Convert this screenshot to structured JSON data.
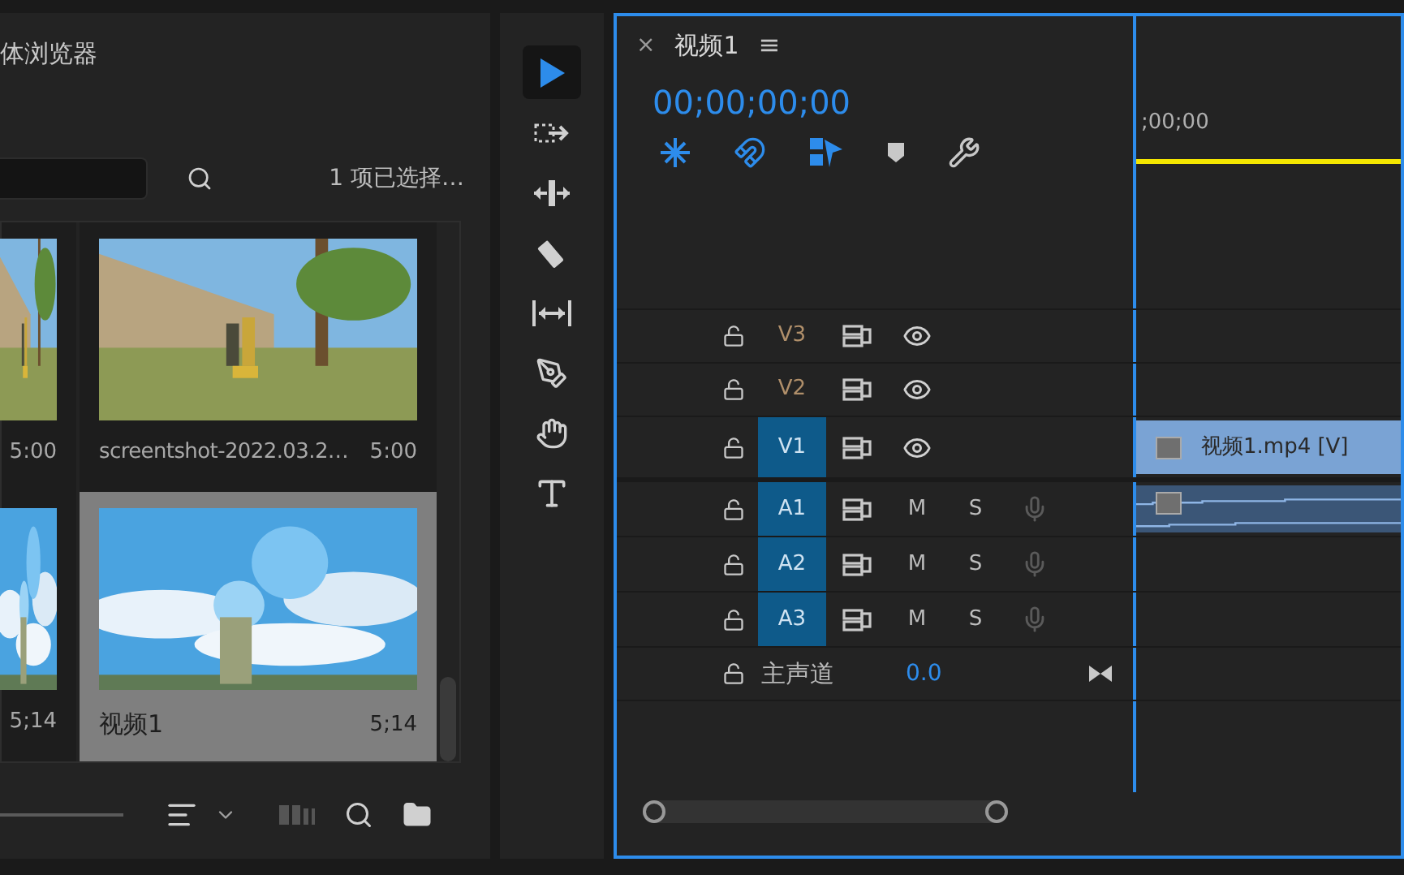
{
  "media_browser": {
    "title": "体浏览器",
    "selection_status": "1 项已选择…",
    "items": [
      {
        "duration": "5:00",
        "selected": false
      },
      {
        "name": "screentshot-2022.03.2…",
        "duration": "5:00",
        "selected": false
      },
      {
        "duration": "5;14",
        "selected": false
      },
      {
        "name": "视频1",
        "duration": "5;14",
        "selected": true
      }
    ]
  },
  "tools": [
    {
      "selected": true
    },
    {
      "selected": false
    },
    {
      "selected": false
    },
    {
      "selected": false
    },
    {
      "selected": false
    },
    {
      "selected": false
    },
    {
      "selected": false
    },
    {
      "selected": false
    }
  ],
  "sequence": {
    "close": "×",
    "title": "视频1",
    "menu": "≡",
    "timecode": "00;00;00;00",
    "ruler_label": ";00;00",
    "tracks": [
      {
        "kind": "video",
        "label": "V3",
        "targeted": false
      },
      {
        "kind": "video",
        "label": "V2",
        "targeted": false
      },
      {
        "kind": "video",
        "label": "V1",
        "targeted": true
      },
      {
        "kind": "audio",
        "label": "A1",
        "targeted": true,
        "mute": "M",
        "solo": "S"
      },
      {
        "kind": "audio",
        "label": "A2",
        "targeted": true,
        "mute": "M",
        "solo": "S"
      },
      {
        "kind": "audio",
        "label": "A3",
        "targeted": true,
        "mute": "M",
        "solo": "S"
      }
    ],
    "master": {
      "label": "主声道",
      "value": "0.0"
    },
    "clips": [
      {
        "kind": "video",
        "label": "视频1.mp4 [V]"
      },
      {
        "kind": "audio"
      }
    ]
  }
}
